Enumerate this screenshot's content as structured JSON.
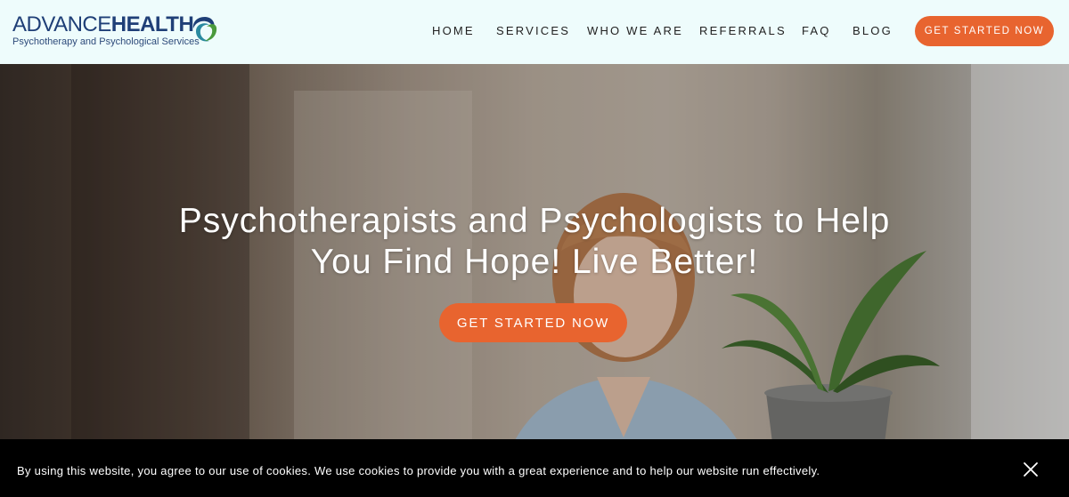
{
  "brand": {
    "name_light": "ADVANCE",
    "name_bold": "HEALTH",
    "tagline": "Psychotherapy and Psychological Services",
    "colors": {
      "navy": "#1f3f77",
      "teal": "#2a8aa0",
      "green": "#4a9a3c",
      "accent": "#e8642f"
    }
  },
  "nav": {
    "items": [
      {
        "label": "HOME"
      },
      {
        "label": "SERVICES"
      },
      {
        "label": "WHO WE ARE"
      },
      {
        "label": "REFERRALS"
      },
      {
        "label": "FAQ"
      },
      {
        "label": "BLOG"
      }
    ],
    "cta_label": "GET STARTED NOW"
  },
  "hero": {
    "title_line1": "Psychotherapists and Psychologists to Help",
    "title_line2": "You Find Hope! Live Better!",
    "cta_label": "GET STARTED NOW"
  },
  "cookie_banner": {
    "text": "By using this website, you agree to our use of cookies. We use cookies to provide you with a great experience and to help our website run effectively.",
    "close_icon": "close-icon"
  }
}
